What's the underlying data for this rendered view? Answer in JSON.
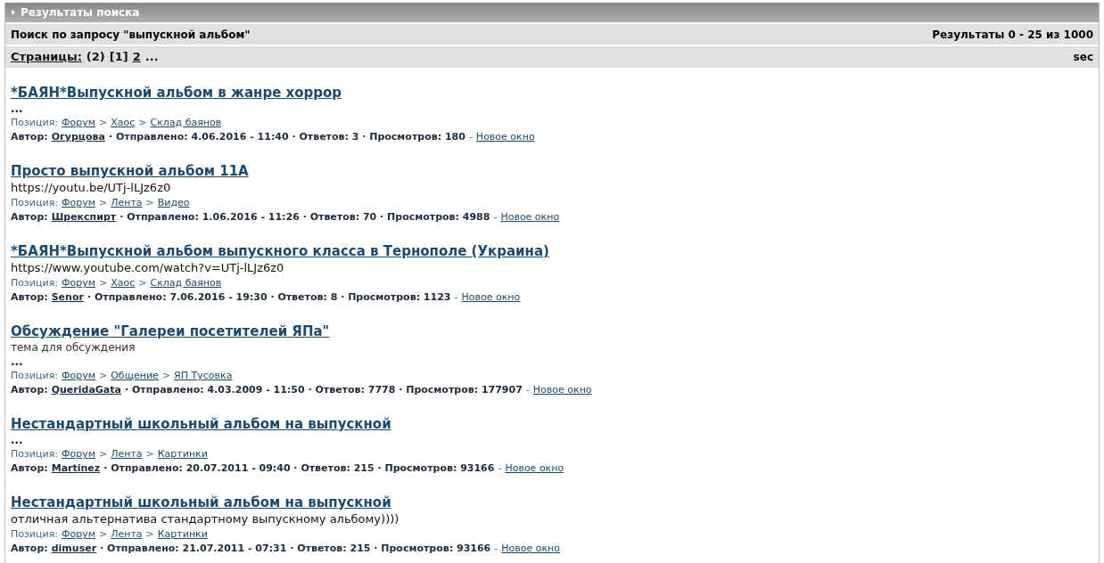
{
  "panel": {
    "title": "Результаты поиска"
  },
  "query_bar": {
    "query": "Поиск по запросу \"выпускной альбом\"",
    "results": "Результаты 0 - 25 из 1000"
  },
  "pages_bar": {
    "label": "Страницы:",
    "items": [
      {
        "text": "(2)",
        "kind": "text"
      },
      {
        "text": "[1]",
        "kind": "text"
      },
      {
        "text": "2",
        "kind": "link"
      },
      {
        "text": "...",
        "kind": "text"
      }
    ],
    "right": "sec"
  },
  "results": [
    {
      "title": "*БАЯН*Выпускной альбом в жанре хоррор",
      "snippet": [
        {
          "kind": "ellipsis",
          "text": "..."
        }
      ],
      "position_label": "Позиция:",
      "crumbs": [
        "Форум",
        "Хаос",
        "Склад баянов"
      ],
      "separators": [
        ">",
        ">"
      ],
      "author_label": "Автор:",
      "author": "Огурцова",
      "meta": "· Отправлено: 4.06.2016 - 11:40 · Ответов: 3 · Просмотров: 180",
      "dash": "-",
      "new_window": "Новое окно"
    },
    {
      "title": "Просто выпускной альбом 11А",
      "snippet": [
        {
          "kind": "text",
          "text": "https://youtu.be/UTj-lLJz6z0"
        }
      ],
      "position_label": "Позиция:",
      "crumbs": [
        "Форум",
        "Лента",
        "Видео"
      ],
      "separators": [
        ">",
        ">"
      ],
      "author_label": "Автор:",
      "author": "Шрекспирт",
      "meta": "· Отправлено: 1.06.2016 - 11:26 · Ответов: 70 · Просмотров: 4988",
      "dash": "-",
      "new_window": "Новое окно"
    },
    {
      "title": "*БАЯН*Выпускной альбом выпускного класса в Тернополе (Украина)",
      "snippet": [
        {
          "kind": "text",
          "text": "https://www.youtube.com/watch?v=UTj-lLJz6z0"
        }
      ],
      "position_label": "Позиция:",
      "crumbs": [
        "Форум",
        "Хаос",
        "Склад баянов"
      ],
      "separators": [
        ">",
        ">"
      ],
      "author_label": "Автор:",
      "author": "Senor",
      "meta": "· Отправлено: 7.06.2016 - 19:30 · Ответов: 8 · Просмотров: 1123",
      "dash": "-",
      "new_window": "Новое окно"
    },
    {
      "title": "Обсуждение \"Галереи посетителей ЯПа\"",
      "snippet": [
        {
          "kind": "small",
          "text": "тема для обсуждения"
        },
        {
          "kind": "ellipsis",
          "text": "..."
        }
      ],
      "position_label": "Позиция:",
      "crumbs": [
        "Форум",
        "Общение",
        "ЯП Тусовка"
      ],
      "separators": [
        ">",
        ">"
      ],
      "author_label": "Автор:",
      "author": "QueridaGata",
      "meta": "· Отправлено: 4.03.2009 - 11:50 · Ответов: 7778 · Просмотров: 177907",
      "dash": "-",
      "new_window": "Новое окно"
    },
    {
      "title": "Нестандартный школьный альбом на выпускной",
      "snippet": [
        {
          "kind": "ellipsis",
          "text": "..."
        }
      ],
      "position_label": "Позиция:",
      "crumbs": [
        "Форум",
        "Лента",
        "Картинки"
      ],
      "separators": [
        ">",
        ">"
      ],
      "author_label": "Автор:",
      "author": "Martinez",
      "meta": "· Отправлено: 20.07.2011 - 09:40 · Ответов: 215 · Просмотров: 93166",
      "dash": "-",
      "new_window": "Новое окно"
    },
    {
      "title": "Нестандартный школьный альбом на выпускной",
      "snippet": [
        {
          "kind": "text",
          "text": "отличная альтернатива стандартному выпускному альбому))))"
        }
      ],
      "position_label": "Позиция:",
      "crumbs": [
        "Форум",
        "Лента",
        "Картинки"
      ],
      "separators": [
        ">",
        ">"
      ],
      "author_label": "Автор:",
      "author": "dimuser",
      "meta": "· Отправлено: 21.07.2011 - 07:31 · Ответов: 215 · Просмотров: 93166",
      "dash": "-",
      "new_window": "Новое окно"
    }
  ]
}
